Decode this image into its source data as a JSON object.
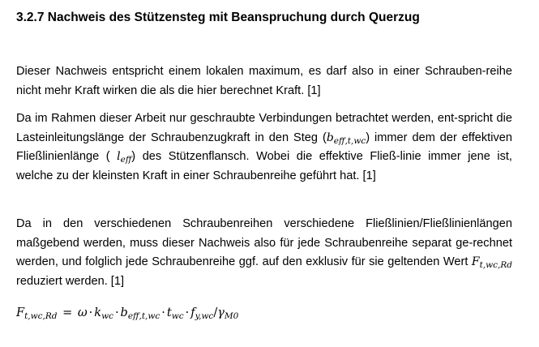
{
  "section": {
    "title": "3.2.7 Nachweis des Stützensteg mit Beanspruchung durch Querzug"
  },
  "paragraph1": {
    "text": "Dieser Nachweis entspricht einem lokalen maximum, es darf also in einer Schrauben-reihe nicht mehr Kraft wirken die als die hier berechnet Kraft. [1]"
  },
  "paragraph2": {
    "part1": "Da im Rahmen dieser Arbeit nur geschraubte Verbindungen betrachtet werden, ent-spricht die Lasteinleitungslänge der Schraubenzugkraft in den Steg (",
    "sym1_base": "b",
    "sym1_sub": "eff,t,wc",
    "part2": ") immer dem der effektiven Fließlinienlänge ( ",
    "sym2_base": "l",
    "sym2_sub": "eff",
    "part3": ") des Stützenflansch. Wobei die effektive Fließ-linie immer jene ist, welche zu der kleinsten Kraft in einer Schraubenreihe geführt hat. [1]"
  },
  "paragraph3": {
    "part1": "Da in den verschiedenen Schraubenreihen verschiedene Fließlinien/Fließlinienlängen maßgebend werden, muss dieser Nachweis also für jede Schraubenreihe separat ge-rechnet werden, und folglich jede Schraubenreihe ggf. auf den exklusiv für sie geltenden Wert ",
    "sym_base": "F",
    "sym_sub": "t,wc,Rd",
    "part2": " reduziert werden. [1]"
  },
  "formula": {
    "lhs_base": "F",
    "lhs_sub": "t,wc,Rd",
    "equals": "=",
    "omega": "ω",
    "dot": "·",
    "k_base": "k",
    "k_sub": "wc",
    "b_base": "b",
    "b_sub": "eff,t,wc",
    "t_base": "t",
    "t_sub": "wc",
    "f_base": "f",
    "f_sub": "y,wc",
    "slash": "/",
    "gamma_base": "γ",
    "gamma_sub": "M0"
  }
}
